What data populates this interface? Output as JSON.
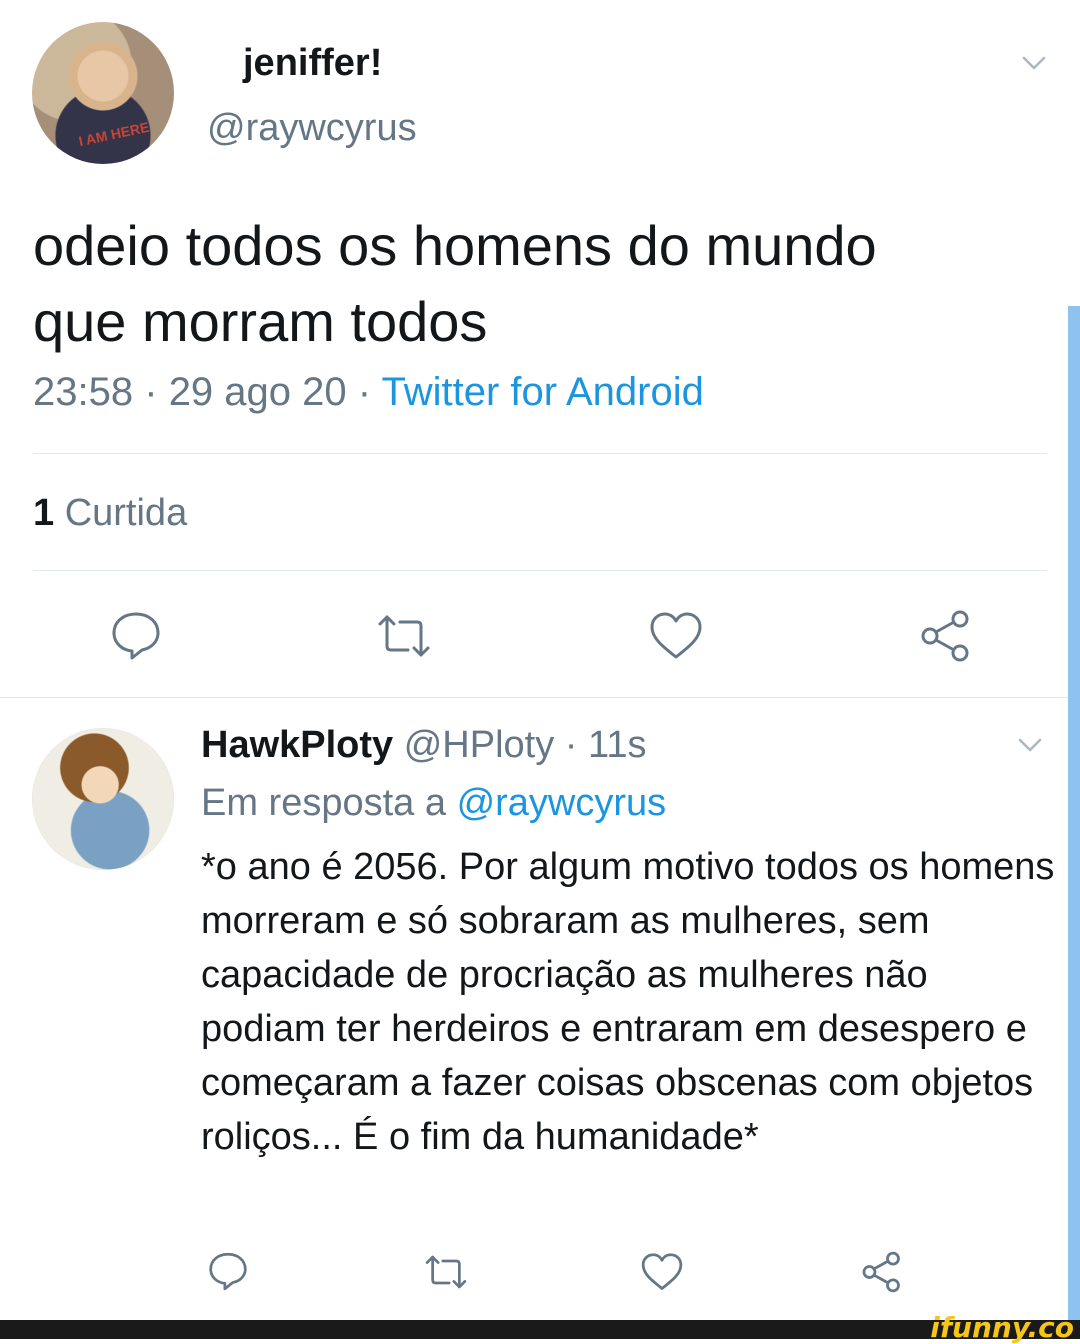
{
  "main_tweet": {
    "display_name": "jeniffer!",
    "handle": "@raywcyrus",
    "avatar_shirt_text": "I AM HERE",
    "text_line1": "odeio todos os homens do mundo",
    "text_line2": "que morram todos",
    "time": "23:58",
    "date": "29 ago 20",
    "source": "Twitter for Android",
    "likes_count": "1",
    "likes_label": "Curtida"
  },
  "reply": {
    "display_name": "HawkPloty",
    "handle": "@HPloty",
    "time_ago": "11s",
    "reply_prefix": "Em resposta a",
    "reply_mention": "@raywcyrus",
    "text": "*o ano é 2056. Por algum motivo todos os homens morreram e só sobraram as mulheres, sem capacidade de procriação as mulheres não podiam ter herdeiros e entraram em desespero e começaram a fazer coisas obscenas com objetos roliços... É o fim da humanidade*"
  },
  "separator": "·",
  "icons": {
    "reply": "reply-icon",
    "retweet": "retweet-icon",
    "like": "heart-icon",
    "share": "share-icon",
    "menu": "chevron-down-icon"
  },
  "colors": {
    "link": "#1b95e0",
    "muted": "#657786",
    "text": "#14171a",
    "watermark": "#f5c51a"
  },
  "watermark": "ifunny.co"
}
